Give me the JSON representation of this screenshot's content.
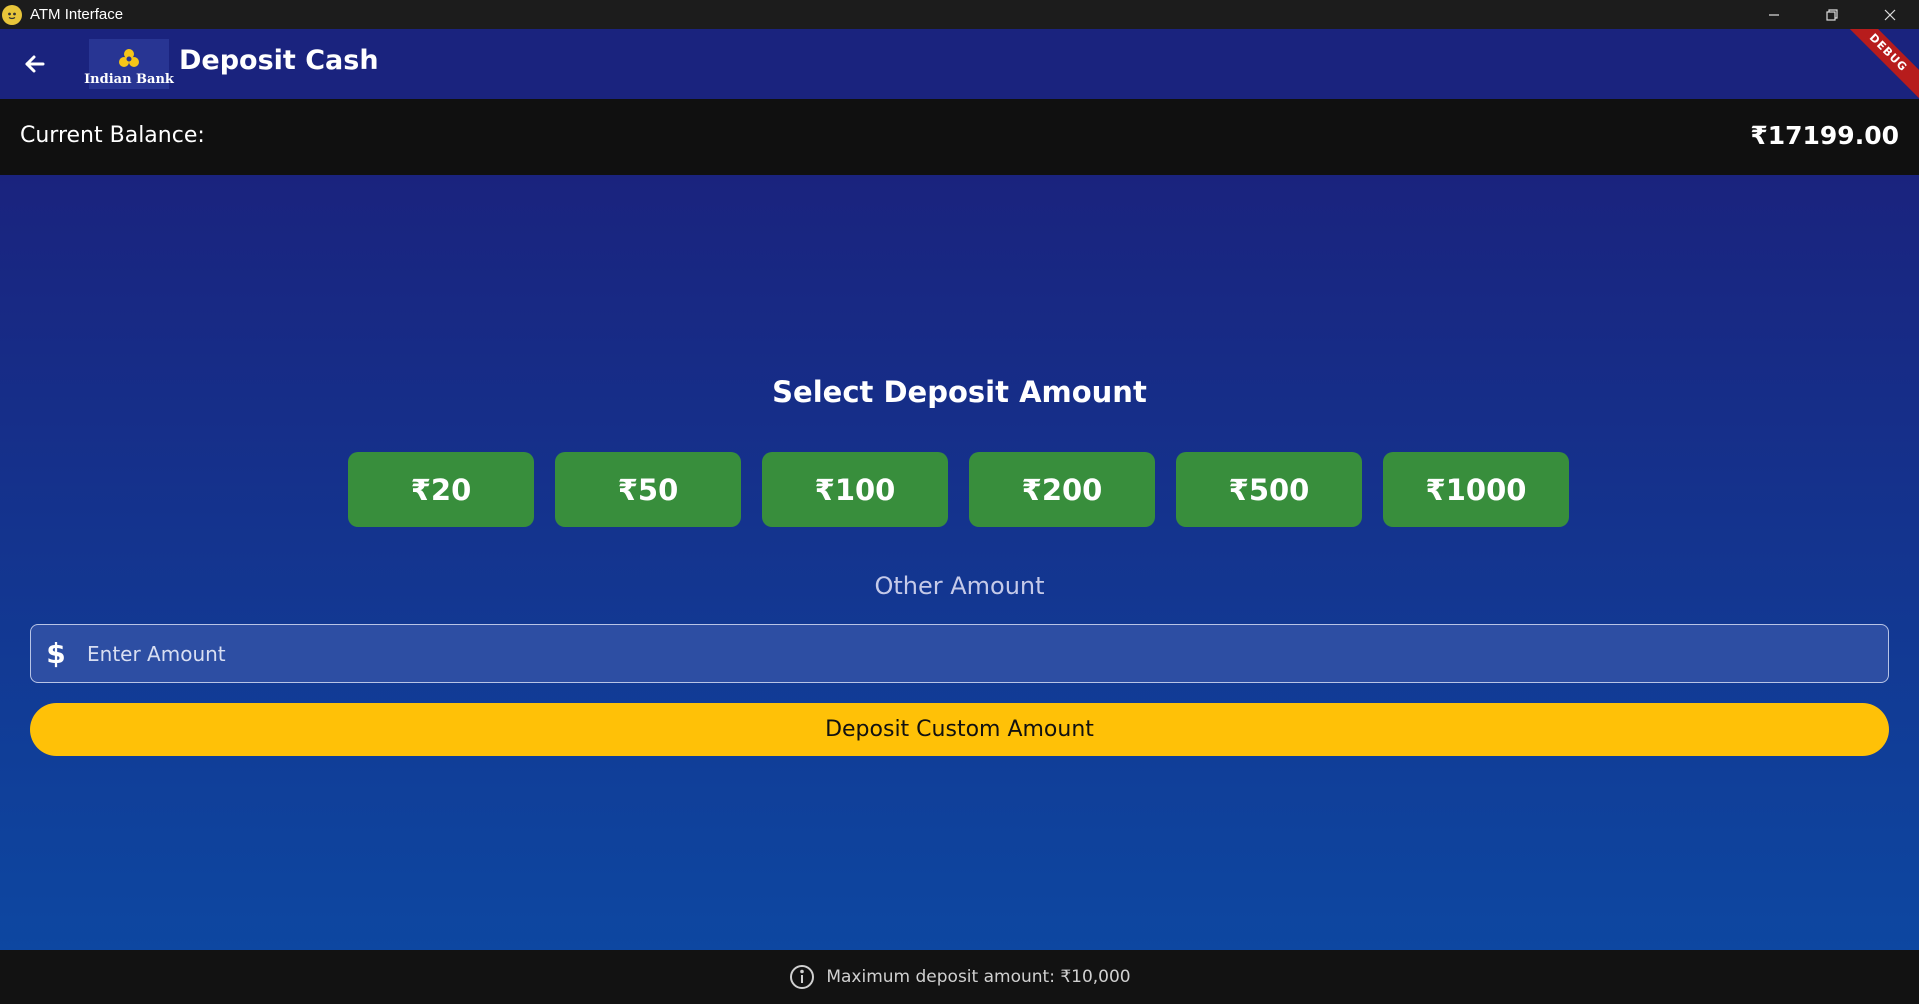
{
  "window": {
    "title": "ATM Interface"
  },
  "appbar": {
    "title": "Deposit Cash",
    "bank_name": "Indian Bank",
    "debug_label": "DEBUG"
  },
  "balance": {
    "label": "Current Balance:",
    "value": "₹17199.00"
  },
  "main": {
    "section_title": "Select Deposit Amount",
    "amounts": [
      "₹20",
      "₹50",
      "₹100",
      "₹200",
      "₹500",
      "₹1000"
    ],
    "other_label": "Other Amount",
    "input_placeholder": "Enter Amount",
    "input_icon": "$",
    "deposit_button": "Deposit Custom Amount"
  },
  "footer": {
    "note": "Maximum deposit amount: ₹10,000"
  },
  "colors": {
    "appbar": "#1a237e",
    "amount_button": "#388e3c",
    "deposit_button": "#ffc107",
    "debug_banner": "#b71c1c"
  }
}
